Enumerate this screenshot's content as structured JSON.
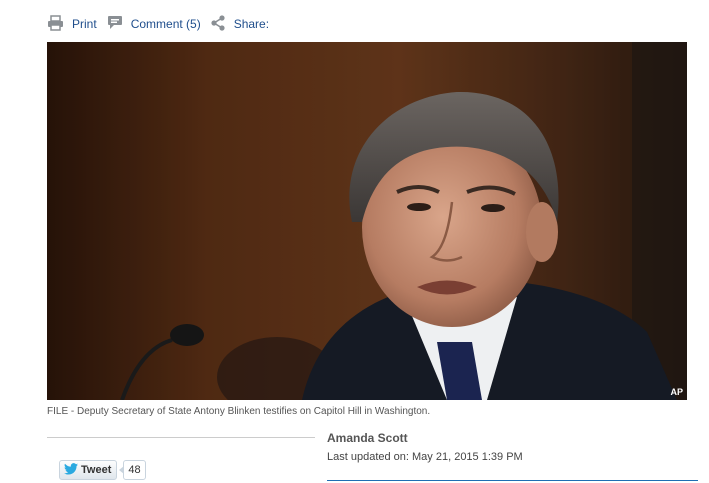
{
  "toolbar": {
    "print_label": "Print",
    "comment_label": "Comment (5)",
    "share_label": "Share:"
  },
  "photo": {
    "credit": "AP",
    "caption": "FILE - Deputy Secretary of State Antony Blinken testifies on Capitol Hill in Washington."
  },
  "byline": {
    "author": "Amanda Scott",
    "updated": "Last updated on: May 21, 2015 1:39 PM"
  },
  "social": {
    "tweet_label": "Tweet",
    "tweet_count": "48"
  },
  "colors": {
    "link": "#1f4e8c",
    "accent_rule": "#1f6fb4",
    "twitter": "#2aa9e0"
  }
}
